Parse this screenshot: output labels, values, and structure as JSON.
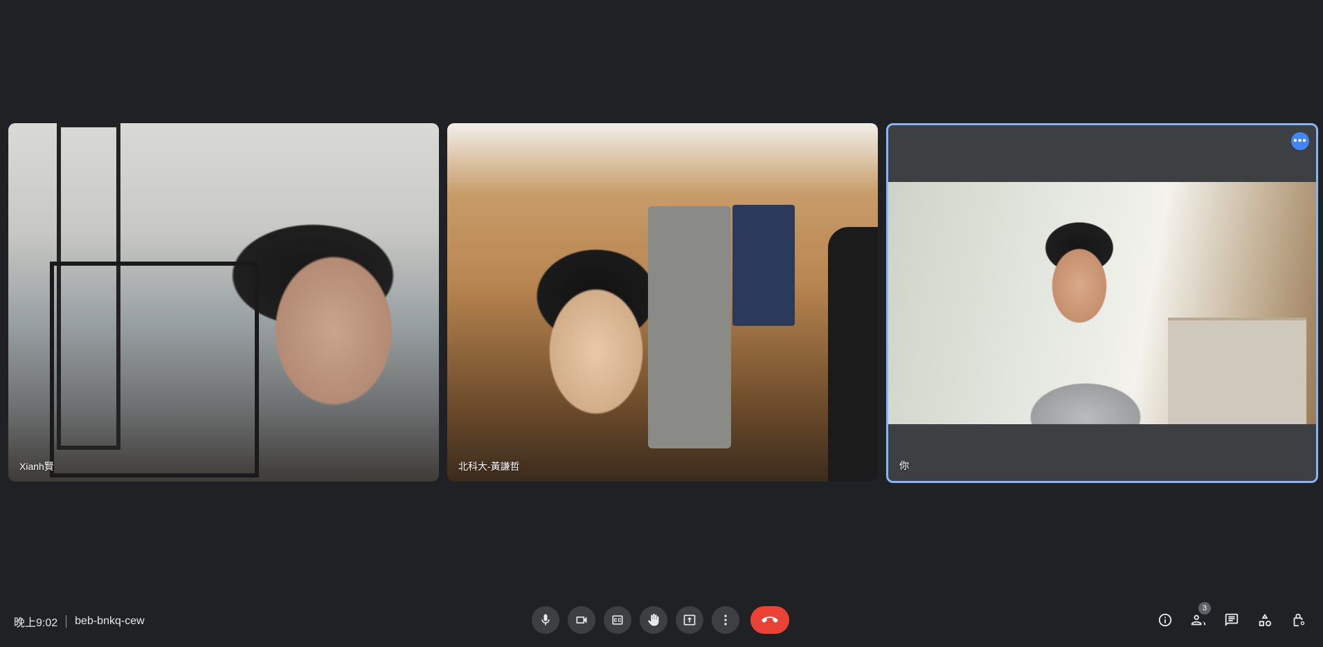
{
  "participants": [
    {
      "name": "Xianh賢"
    },
    {
      "name": "北科大-黃謙哲"
    },
    {
      "name": "你"
    }
  ],
  "meeting": {
    "time": "晚上9:02",
    "code": "beb-bnkq-cew"
  },
  "people_count": "3",
  "icons": {
    "mic": "microphone-icon",
    "camera": "camera-icon",
    "captions": "captions-icon",
    "hand": "raise-hand-icon",
    "present": "present-screen-icon",
    "more": "more-vert-icon",
    "hangup": "hang-up-icon",
    "info": "info-icon",
    "people": "people-icon",
    "chat": "chat-icon",
    "activities": "activities-icon",
    "host": "host-controls-icon"
  },
  "colors": {
    "background": "#202124",
    "accent": "#8ab4f8",
    "hangup": "#ea4335"
  }
}
